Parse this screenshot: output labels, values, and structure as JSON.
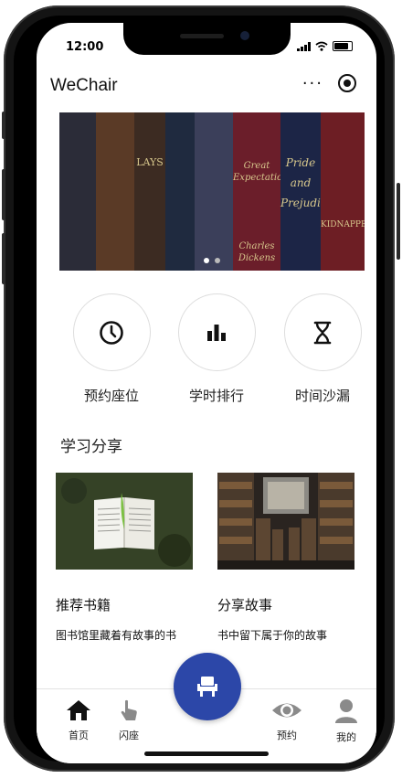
{
  "status_bar": {
    "time": "12:00"
  },
  "header": {
    "title": "WeChair",
    "more_glyph": "···"
  },
  "banner": {
    "book_spines": [
      "LAYS",
      "Great Expectations",
      "Pride and Prejudice",
      "KIDNAPPED",
      "Charles Dickens"
    ]
  },
  "quick_nav": [
    {
      "label": "预约座位",
      "icon": "clock-icon"
    },
    {
      "label": "学时排行",
      "icon": "bar-chart-icon"
    },
    {
      "label": "时间沙漏",
      "icon": "hourglass-icon"
    }
  ],
  "section": {
    "title": "学习分享"
  },
  "cards": [
    {
      "title": "推荐书籍",
      "desc": "图书馆里藏着有故事的书",
      "image": "open-book-on-grass"
    },
    {
      "title": "分享故事",
      "desc": "书中留下属于你的故事",
      "image": "library-shelves"
    }
  ],
  "tabbar": {
    "items": [
      {
        "label": "首页",
        "icon": "home-icon"
      },
      {
        "label": "闪座",
        "icon": "tap-hand-icon"
      },
      {
        "label": "预约",
        "icon": "eye-icon"
      },
      {
        "label": "我的",
        "icon": "user-icon"
      }
    ],
    "center_icon": "chair-icon"
  },
  "colors": {
    "accent": "#2c47a8",
    "tab_active": "#222222",
    "tab_inactive": "#9a9a9a"
  }
}
